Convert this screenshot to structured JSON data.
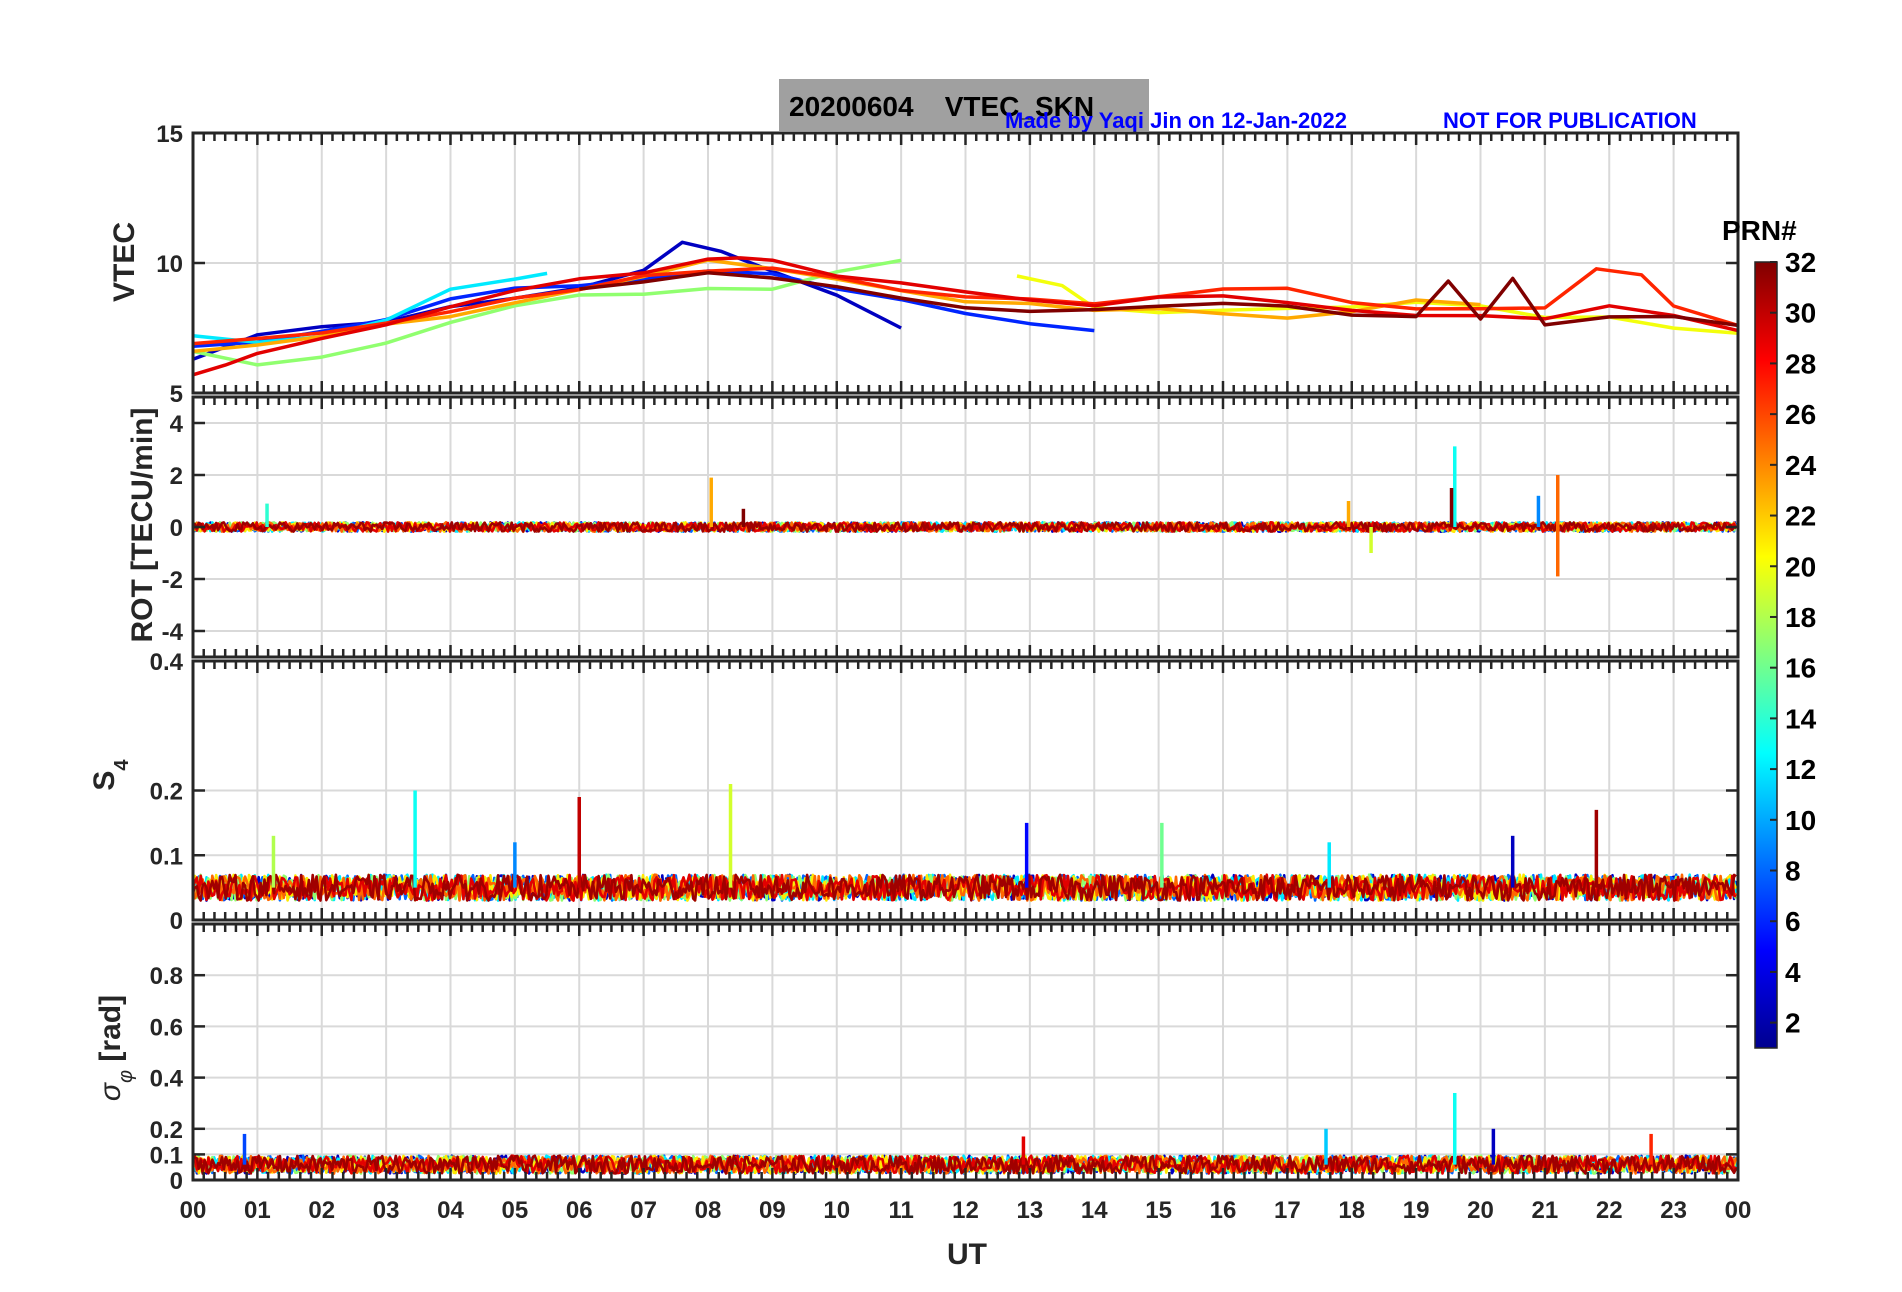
{
  "title": "20200604    VTEC_SKN",
  "credit": "Made by Yaqi Jin on 12-Jan-2022",
  "warning": "NOT FOR PUBLICATION",
  "credit_color": "#0000ff",
  "colorbar": {
    "title": "PRN#",
    "ticks": [
      "2",
      "4",
      "6",
      "8",
      "10",
      "12",
      "14",
      "16",
      "18",
      "20",
      "22",
      "24",
      "26",
      "28",
      "30",
      "32"
    ],
    "range": [
      1,
      32
    ],
    "colormap": "jet"
  },
  "chart_data": [
    {
      "type": "line",
      "ylabel": "VTEC",
      "ylim": [
        5,
        15
      ],
      "yticks": [
        "5",
        "10",
        "15"
      ],
      "grid": true,
      "series": [
        {
          "prn": 3,
          "x": [
            0,
            1,
            2,
            3,
            4,
            5,
            6,
            7,
            7.6,
            8.2,
            9,
            10,
            11
          ],
          "values": [
            6.3,
            7.2,
            7.6,
            7.7,
            8.2,
            8.6,
            9.0,
            9.8,
            10.7,
            10.4,
            9.6,
            8.7,
            7.5
          ]
        },
        {
          "prn": 6,
          "x": [
            0,
            1,
            2,
            3,
            4,
            5,
            6,
            7,
            8,
            9,
            10,
            11,
            12,
            13,
            14
          ],
          "values": [
            6.8,
            7.0,
            7.3,
            7.9,
            8.6,
            9.1,
            9.2,
            9.3,
            9.6,
            9.5,
            9.1,
            8.6,
            8.0,
            7.7,
            7.4
          ]
        },
        {
          "prn": 12,
          "x": [
            0,
            1,
            2,
            3,
            4,
            5,
            5.5
          ],
          "values": [
            7.2,
            7.0,
            7.2,
            7.7,
            8.9,
            9.4,
            9.6
          ]
        },
        {
          "prn": 17,
          "x": [
            0,
            1,
            2,
            3,
            4,
            5,
            6,
            7,
            8,
            9,
            10,
            11
          ],
          "values": [
            6.6,
            6.1,
            6.3,
            7.0,
            7.8,
            8.4,
            8.8,
            8.8,
            8.9,
            9.0,
            9.6,
            10.1
          ]
        },
        {
          "prn": 20,
          "x": [
            12.8,
            13.5,
            14,
            15,
            16,
            17,
            18,
            19,
            20,
            21,
            22,
            23,
            24
          ],
          "values": [
            9.5,
            9.2,
            8.3,
            8.0,
            8.1,
            8.3,
            8.3,
            8.4,
            8.3,
            8.0,
            7.9,
            7.6,
            7.3
          ]
        },
        {
          "prn": 23,
          "x": [
            0,
            1,
            2,
            3,
            4,
            5,
            6,
            7,
            8,
            9,
            10,
            11,
            12,
            13,
            14,
            15,
            16,
            17,
            18,
            19,
            20
          ],
          "values": [
            6.6,
            6.8,
            7.2,
            7.6,
            8.0,
            8.5,
            9.0,
            9.5,
            10.0,
            9.8,
            9.5,
            9.0,
            8.6,
            8.4,
            8.3,
            8.3,
            8.1,
            7.9,
            8.2,
            8.5,
            8.4
          ]
        },
        {
          "prn": 27,
          "x": [
            0,
            1,
            2,
            3,
            4,
            5,
            6,
            7,
            8,
            9,
            10,
            11,
            12,
            13,
            14,
            15,
            16,
            17,
            18,
            19,
            20,
            21,
            21.8,
            22.5,
            23,
            24
          ],
          "values": [
            6.9,
            7.1,
            7.3,
            7.6,
            8.1,
            8.6,
            9.1,
            9.5,
            9.7,
            9.8,
            9.4,
            9.0,
            8.7,
            8.5,
            8.5,
            8.7,
            8.9,
            9.0,
            8.6,
            8.2,
            8.2,
            8.3,
            9.7,
            9.5,
            8.4,
            7.6
          ]
        },
        {
          "prn": 29,
          "x": [
            0,
            0.5,
            1,
            2,
            3,
            4,
            5,
            6,
            7,
            8,
            8.5,
            9,
            10,
            11,
            12,
            13,
            14,
            15,
            16,
            17,
            18,
            19,
            20,
            21,
            22,
            23,
            24
          ],
          "values": [
            5.7,
            6.0,
            6.4,
            7.1,
            7.7,
            8.3,
            8.9,
            9.3,
            9.6,
            10.1,
            10.3,
            10.0,
            9.6,
            9.3,
            8.9,
            8.5,
            8.4,
            8.6,
            8.8,
            8.4,
            8.2,
            8.0,
            8.1,
            7.9,
            8.3,
            7.9,
            7.4
          ]
        },
        {
          "prn": 32,
          "x": [
            6,
            7,
            8,
            9,
            10,
            11,
            12,
            13,
            14,
            15,
            16,
            17,
            18,
            19,
            19.5,
            20,
            20.5,
            21,
            22,
            23,
            24
          ],
          "values": [
            9.0,
            9.2,
            9.5,
            9.4,
            9.0,
            8.7,
            8.4,
            8.2,
            8.2,
            8.3,
            8.4,
            8.3,
            8.0,
            7.9,
            9.2,
            7.8,
            9.5,
            7.6,
            8.0,
            7.9,
            7.6
          ]
        }
      ]
    },
    {
      "type": "line",
      "ylabel": "ROT [TECU/min]",
      "ylim": [
        -5,
        5
      ],
      "yticks": [
        "-4",
        "-2",
        "0",
        "2",
        "4"
      ],
      "grid": true,
      "baseline": 0,
      "noise": 0.18,
      "spikes": [
        {
          "prn": 23,
          "x": 8.05,
          "value": 1.9
        },
        {
          "prn": 32,
          "x": 8.55,
          "value": 0.7
        },
        {
          "prn": 13,
          "x": 19.6,
          "value": 3.1
        },
        {
          "prn": 32,
          "x": 19.55,
          "value": 1.5
        },
        {
          "prn": 25,
          "x": 21.2,
          "value": 2.0
        },
        {
          "prn": 25,
          "x": 21.2,
          "value": -1.9
        },
        {
          "prn": 19,
          "x": 18.3,
          "value": -1.0
        },
        {
          "prn": 14,
          "x": 1.15,
          "value": 0.9
        },
        {
          "prn": 23,
          "x": 17.95,
          "value": 1.0
        },
        {
          "prn": 9,
          "x": 20.9,
          "value": 1.2
        }
      ]
    },
    {
      "type": "line",
      "ylabel": "S4",
      "ylim": [
        0,
        0.4
      ],
      "yticks": [
        "0",
        "0.1",
        "0.2"
      ],
      "grid": true,
      "baseline": 0.05,
      "noise": 0.02,
      "spikes": [
        {
          "prn": 13,
          "x": 3.45,
          "value": 0.2
        },
        {
          "prn": 30,
          "x": 6.0,
          "value": 0.19
        },
        {
          "prn": 19,
          "x": 8.35,
          "value": 0.21
        },
        {
          "prn": 31,
          "x": 21.8,
          "value": 0.17
        },
        {
          "prn": 5,
          "x": 12.95,
          "value": 0.15
        },
        {
          "prn": 16,
          "x": 15.05,
          "value": 0.15
        },
        {
          "prn": 3,
          "x": 20.5,
          "value": 0.13
        },
        {
          "prn": 18,
          "x": 1.25,
          "value": 0.13
        },
        {
          "prn": 12,
          "x": 17.65,
          "value": 0.12
        },
        {
          "prn": 9,
          "x": 5.0,
          "value": 0.12
        }
      ]
    },
    {
      "type": "line",
      "ylabel": "σ_φ [rad]",
      "ylim": [
        0,
        1
      ],
      "yticks": [
        "0",
        "0.1",
        "0.2",
        "0.4",
        "0.6",
        "0.8"
      ],
      "grid": true,
      "baseline": 0.06,
      "noise": 0.035,
      "spikes": [
        {
          "prn": 13,
          "x": 19.6,
          "value": 0.34
        },
        {
          "prn": 3,
          "x": 20.2,
          "value": 0.2
        },
        {
          "prn": 11,
          "x": 17.6,
          "value": 0.2
        },
        {
          "prn": 27,
          "x": 22.65,
          "value": 0.18
        },
        {
          "prn": 7,
          "x": 0.8,
          "value": 0.18
        },
        {
          "prn": 29,
          "x": 12.9,
          "value": 0.17
        }
      ]
    }
  ],
  "xaxis": {
    "label": "UT",
    "xlim": [
      0,
      24
    ],
    "ticks": [
      "00",
      "01",
      "02",
      "03",
      "04",
      "05",
      "06",
      "07",
      "08",
      "09",
      "10",
      "11",
      "12",
      "13",
      "14",
      "15",
      "16",
      "17",
      "18",
      "19",
      "20",
      "21",
      "22",
      "23",
      "00"
    ]
  }
}
